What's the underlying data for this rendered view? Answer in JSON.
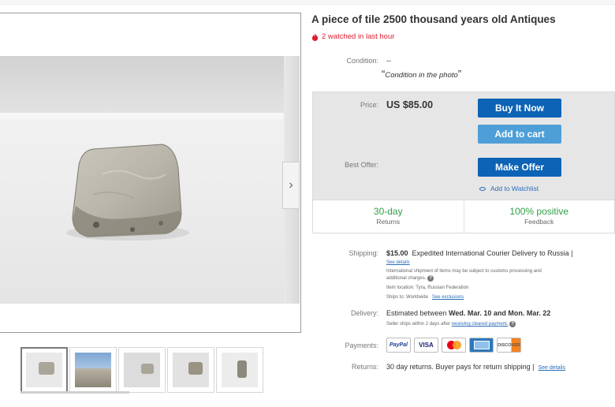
{
  "listing": {
    "title": "A piece of tile 2500 thousand years old Antiques",
    "watched": "2 watched in last hour"
  },
  "condition": {
    "label": "Condition:",
    "value": "--",
    "note": "Condition in the photo"
  },
  "buy": {
    "price_label": "Price:",
    "price": "US $85.00",
    "buy_now": "Buy It Now",
    "add_to_cart": "Add to cart",
    "best_offer_label": "Best Offer:",
    "make_offer": "Make Offer",
    "add_watchlist": "Add to Watchlist"
  },
  "stats": {
    "returns_big": "30-day",
    "returns_small": "Returns",
    "feedback_big": "100% positive",
    "feedback_small": "Feedback"
  },
  "shipping": {
    "label": "Shipping:",
    "cost": "$15.00",
    "method": "Expedited International Courier Delivery to Russia |",
    "see_details": "See details",
    "note1": "International shipment of items may be subject to customs processing and",
    "note2": "additional charges.",
    "location": "Item location:  Tyra, Russian Federation",
    "ships_to": "Ships to:  Worldwide",
    "see_exclusions": "See exclusions"
  },
  "delivery": {
    "label": "Delivery:",
    "estimated": "Estimated between",
    "dates": "Wed. Mar. 10 and Mon. Mar. 22",
    "note": "Seller ships within 2 days after",
    "note_link": "receiving cleared payment."
  },
  "payments": {
    "label": "Payments:",
    "paypal": "PayPal",
    "visa": "VISA",
    "discover": "DISCOVER"
  },
  "returns": {
    "label": "Returns:",
    "text": "30 day returns. Buyer pays for return shipping |",
    "see_details": "See details"
  },
  "gallery": {
    "next_arrow": "›"
  },
  "colors": {
    "primary_button": "#0d63b5",
    "secondary_button": "#4e9fd8",
    "watch_red": "#dd1e31",
    "positive_green": "#2f9e46",
    "link_blue": "#2a6dbb"
  }
}
